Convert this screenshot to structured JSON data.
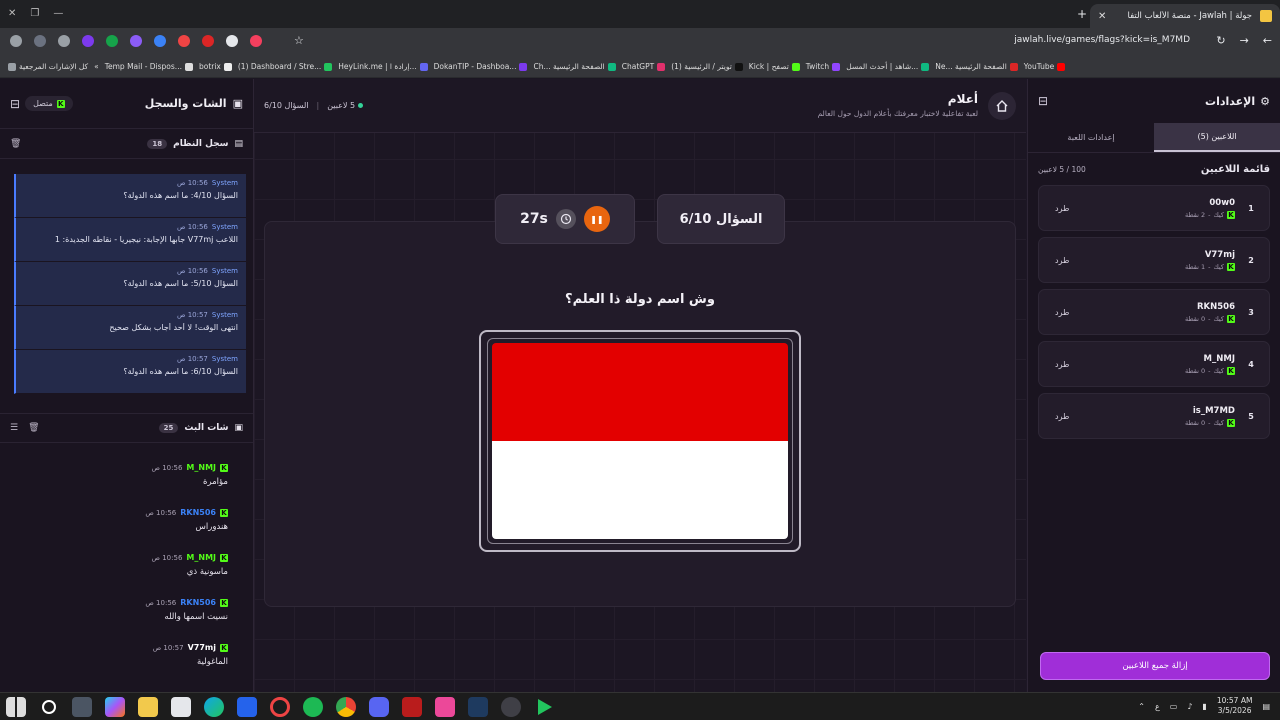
{
  "browser": {
    "tab_title": "جولة | Jawlah - منصة الألعاب التفا",
    "url": "jawlah.live/games/flags?kick=is_M7MD",
    "bookmarks": [
      "كل الإشارات المرجعية",
      "Temp Mail - Dispos...",
      "botrix",
      "(1) Dashboard / Stre...",
      "HeyLink.me | إرادة ا...",
      "DokanTIP - Dashboa...",
      "Ch... الصفحة الرئيسية",
      "ChatGPT",
      "(1) تويتر / الرئيسية",
      "Kick | تصفح",
      "Twitch",
      "شاهد | أحدث المسل...",
      "Ne... الصفحة الرئيسية",
      "YouTube"
    ]
  },
  "chat_panel": {
    "title": "الشات والسجل",
    "connection": "متصل",
    "syslog_title": "سجل النظام",
    "syslog_count": "18",
    "system_messages": [
      {
        "who": "System",
        "time": "10:56 ص",
        "text": "السؤال 4/10: ما اسم هذه الدولة؟"
      },
      {
        "who": "System",
        "time": "10:56 ص",
        "text": "اللاعب V77mj جابها الإجابة: نيجيريا - نقاطه الجديدة: 1"
      },
      {
        "who": "System",
        "time": "10:56 ص",
        "text": "السؤال 5/10: ما اسم هذه الدولة؟"
      },
      {
        "who": "System",
        "time": "10:57 ص",
        "text": "انتهى الوقت! لا أحد أجاب بشكل صحيح"
      },
      {
        "who": "System",
        "time": "10:57 ص",
        "text": "السؤال 6/10: ما اسم هذه الدولة؟"
      }
    ],
    "chat_title": "شات البث",
    "chat_count": "25",
    "messages": [
      {
        "user": "M_NMJ",
        "time": "10:56 ص",
        "text": "مؤامرة",
        "color": "#53fc18"
      },
      {
        "user": "RKN506",
        "time": "10:56 ص",
        "text": "هندوراس",
        "color": "#3b82f6"
      },
      {
        "user": "M_NMJ",
        "time": "10:56 ص",
        "text": "ماسونية ذي",
        "color": "#53fc18"
      },
      {
        "user": "RKN506",
        "time": "10:56 ص",
        "text": "نسيت اسمها والله",
        "color": "#3b82f6"
      },
      {
        "user": "V77mj",
        "time": "10:57 ص",
        "text": "الماغولية",
        "color": "#ffffff"
      }
    ]
  },
  "game": {
    "title": "أعلام",
    "description": "لعبة تفاعلية لاختبار معرفتك بأعلام الدول حول العالم",
    "players_status": "5 لاعبين",
    "question_status": "السؤال 6/10",
    "question_label": "السؤال 6/10",
    "timer": "27s",
    "question": "وش اسم دولة ذا العلم؟",
    "flag_colors": [
      "#e30000",
      "#ffffff"
    ]
  },
  "settings": {
    "title": "الإعدادات",
    "tab_players": "اللاعبين (5)",
    "tab_game": "إعدادات اللعبة",
    "list_title": "قائمة اللاعبين",
    "count": "100 / 5 لاعبين",
    "kick_label": "طرد",
    "players": [
      {
        "rank": "1",
        "name": "00w0",
        "platform": "كيك",
        "points": "2 نقطة"
      },
      {
        "rank": "2",
        "name": "V77mj",
        "platform": "كيك",
        "points": "1 نقطة"
      },
      {
        "rank": "3",
        "name": "RKN506",
        "platform": "كيك",
        "points": "0 نقطة"
      },
      {
        "rank": "4",
        "name": "M_NMJ",
        "platform": "كيك",
        "points": "0 نقطة"
      },
      {
        "rank": "5",
        "name": "is_M7MD",
        "platform": "كيك",
        "points": "0 نقطة"
      }
    ],
    "remove_all": "إزالة جميع اللاعبين"
  },
  "taskbar": {
    "time": "10:57 AM",
    "date": "3/5/2026",
    "lang": "ع"
  }
}
